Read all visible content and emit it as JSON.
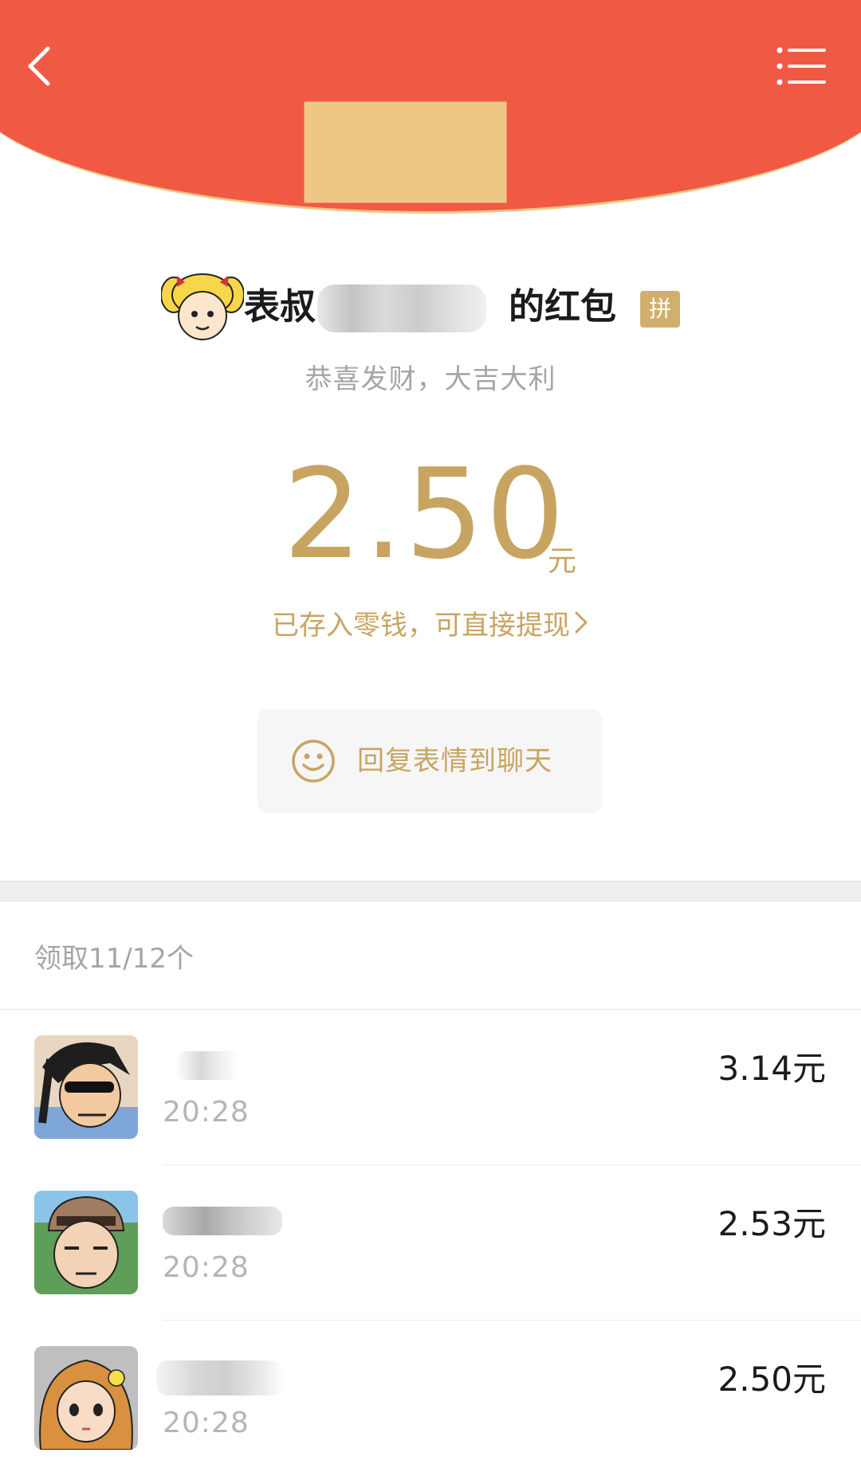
{
  "header": {
    "color": "#F05A45",
    "back_icon": "chevron-left-icon",
    "menu_icon": "list-icon"
  },
  "sender": {
    "prefix": "表叔",
    "suffix": "的红包",
    "badge": "拼",
    "greeting": "恭喜发财，大吉大利"
  },
  "amount": {
    "value": "2.50",
    "unit": "元",
    "wallet_note": "已存入零钱，可直接提现",
    "accent_color": "#C8A463"
  },
  "reply": {
    "label": "回复表情到聊天",
    "icon": "smile-icon"
  },
  "list": {
    "count_label": "领取11/12个",
    "rows": [
      {
        "time": "20:28",
        "amount": "3.14元"
      },
      {
        "time": "20:28",
        "amount": "2.53元"
      },
      {
        "time": "20:28",
        "amount": "2.50元"
      }
    ]
  }
}
